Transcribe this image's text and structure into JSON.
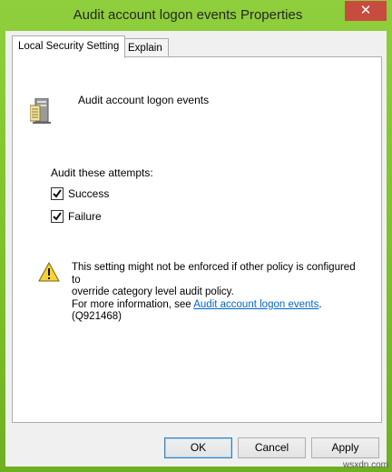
{
  "window": {
    "title": "Audit account logon events Properties",
    "close_glyph": "✕"
  },
  "tabs": [
    {
      "label": "Local Security Setting"
    },
    {
      "label": "Explain"
    }
  ],
  "policy": {
    "icon": "server-policy-icon",
    "name": "Audit account logon events"
  },
  "audit": {
    "label": "Audit these attempts:",
    "options": [
      {
        "label": "Success",
        "checked": true
      },
      {
        "label": "Failure",
        "checked": true
      }
    ]
  },
  "warning": {
    "icon": "warning-icon",
    "line1": "This setting might not be enforced if other policy is configured to",
    "line2": "override category level audit policy.",
    "line3_prefix": "For more information, see",
    "link_text": "Audit account logon events",
    "line3_suffix": ". (Q921468)"
  },
  "buttons": {
    "ok": "OK",
    "cancel": "Cancel",
    "apply": "Apply"
  },
  "watermark": "wsxdn.com"
}
